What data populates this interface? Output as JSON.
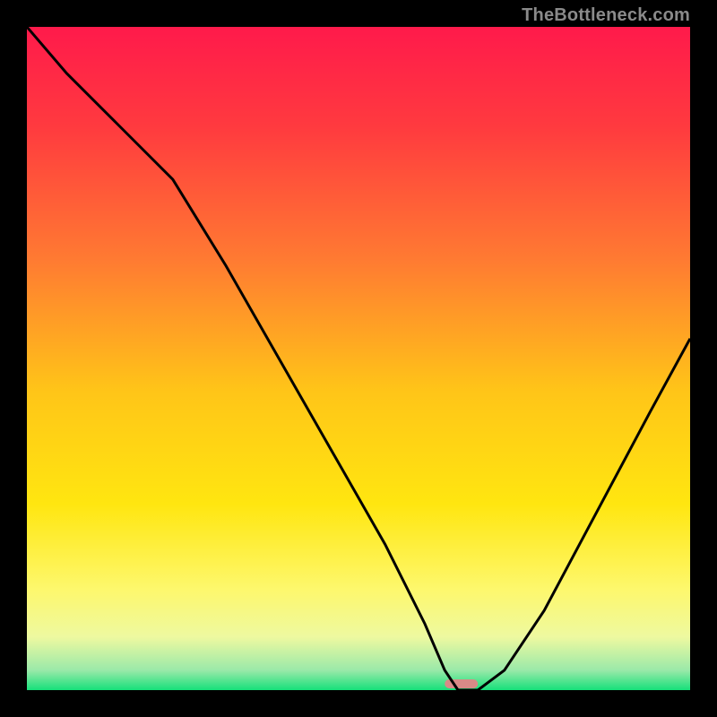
{
  "watermark": "TheBottleneck.com",
  "chart_data": {
    "type": "line",
    "title": "",
    "xlabel": "",
    "ylabel": "",
    "xlim": [
      0,
      100
    ],
    "ylim": [
      0,
      100
    ],
    "grid": false,
    "series": [
      {
        "name": "bottleneck-curve",
        "x": [
          0,
          6,
          14,
          22,
          30,
          38,
          46,
          54,
          60,
          63,
          65,
          68,
          72,
          78,
          86,
          94,
          100
        ],
        "values": [
          100,
          93,
          85,
          77,
          64,
          50,
          36,
          22,
          10,
          3,
          0,
          0,
          3,
          12,
          27,
          42,
          53
        ]
      }
    ],
    "marker": {
      "x_start": 63,
      "x_end": 68,
      "color": "#d88a87"
    },
    "gradient_stops": [
      {
        "offset": 0.0,
        "color": "#ff1a4b"
      },
      {
        "offset": 0.15,
        "color": "#ff3a3f"
      },
      {
        "offset": 0.35,
        "color": "#ff7a32"
      },
      {
        "offset": 0.55,
        "color": "#ffc518"
      },
      {
        "offset": 0.72,
        "color": "#ffe610"
      },
      {
        "offset": 0.85,
        "color": "#fdf86e"
      },
      {
        "offset": 0.92,
        "color": "#eef9a0"
      },
      {
        "offset": 0.97,
        "color": "#9ae9a9"
      },
      {
        "offset": 1.0,
        "color": "#16e07a"
      }
    ]
  }
}
